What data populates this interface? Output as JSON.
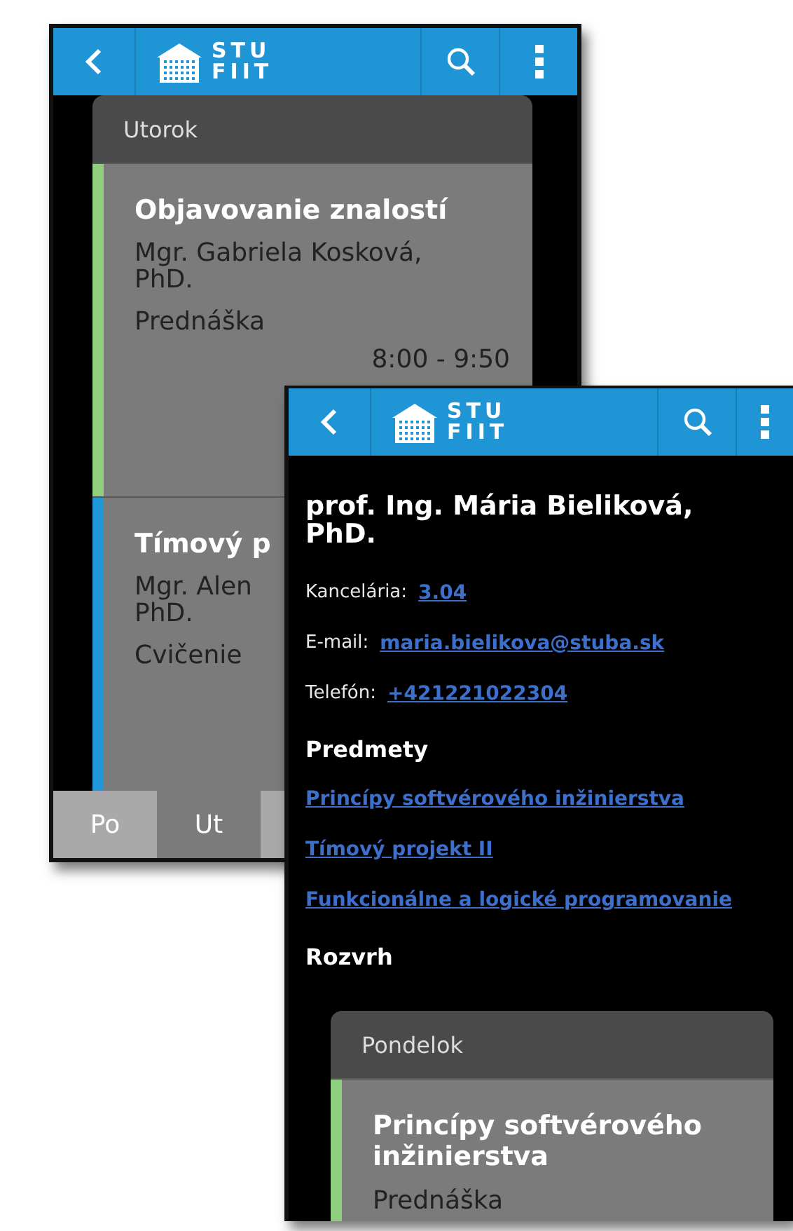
{
  "back_screen": {
    "app_bar": {
      "logo": {
        "line_1": "STU",
        "line_2": "FIIT"
      }
    },
    "day_card": {
      "day": "Utorok",
      "lessons": [
        {
          "title": "Objavovanie znalostí",
          "teacher": "Mgr. Gabriela Kosková, PhD.",
          "type": "Prednáška",
          "time": "8:00 - 9:50",
          "color": "#8fcf7f"
        },
        {
          "title": "Tímový p",
          "teacher_line_1": "Mgr. Alen",
          "teacher_line_2": "PhD.",
          "type": "Cvičenie",
          "color": "#2196d8"
        }
      ]
    },
    "day_tabs": [
      {
        "label": "Po",
        "selected": false
      },
      {
        "label": "Ut",
        "selected": true
      },
      {
        "selected": false
      }
    ]
  },
  "front_screen": {
    "app_bar": {
      "logo": {
        "line_1": "STU",
        "line_2": "FIIT"
      }
    },
    "name": "prof. Ing. Mária Bieliková, PhD.",
    "fields": [
      {
        "label": "Kancelária:",
        "value": "3.04"
      },
      {
        "label": "E-mail:",
        "value": "maria.bielikova@stuba.sk"
      },
      {
        "label": "Telefón:",
        "value": "+421221022304"
      }
    ],
    "subjects_heading": "Predmety",
    "subjects": [
      "Princípy softvérového inžinierstva",
      "Tímový projekt II",
      "Funkcionálne a logické programovanie"
    ],
    "schedule_heading": "Rozvrh",
    "day_card": {
      "day": "Pondelok",
      "lessons": [
        {
          "title": "Princípy softvérového inžinierstva",
          "type": "Prednáška",
          "color": "#8fcf7f"
        }
      ]
    }
  }
}
